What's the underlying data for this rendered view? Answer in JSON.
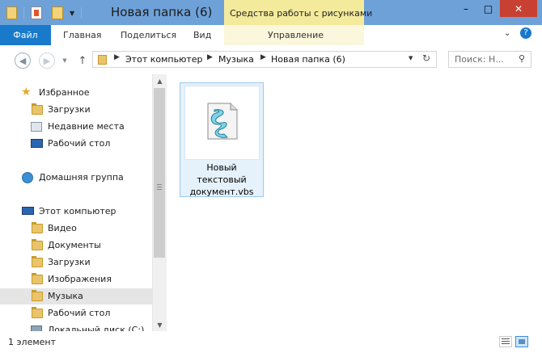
{
  "window": {
    "title": "Новая папка (6)",
    "context_tab": "Средства работы с рисунками",
    "controls": {
      "minimize": "–",
      "maximize": "□",
      "close": "✕"
    }
  },
  "ribbon": {
    "tabs": [
      {
        "label": "Файл"
      },
      {
        "label": "Главная"
      },
      {
        "label": "Поделиться"
      },
      {
        "label": "Вид"
      },
      {
        "label": "Управление"
      }
    ]
  },
  "navbar": {
    "breadcrumb": [
      "Этот компьютер",
      "Музыка",
      "Новая папка (6)"
    ],
    "search_placeholder": "Поиск: Н..."
  },
  "nav_pane": {
    "favorites": {
      "label": "Избранное",
      "items": [
        "Загрузки",
        "Недавние места",
        "Рабочий стол"
      ]
    },
    "homegroup": "Домашняя группа",
    "computer": {
      "label": "Этот компьютер",
      "items": [
        "Видео",
        "Документы",
        "Загрузки",
        "Изображения",
        "Музыка",
        "Рабочий стол",
        "Локальный диск (C:)"
      ]
    },
    "selected": "Музыка"
  },
  "content": {
    "files": [
      {
        "name": "Новый текстовый документ.vbs",
        "icon": "vbs-script-icon"
      }
    ]
  },
  "status": {
    "count": "1 элемент"
  },
  "colors": {
    "titlebar": "#6ea1d8",
    "file_tab": "#1979ca",
    "context_tab": "#f3ea9c",
    "selection": "#e5f1fb"
  }
}
